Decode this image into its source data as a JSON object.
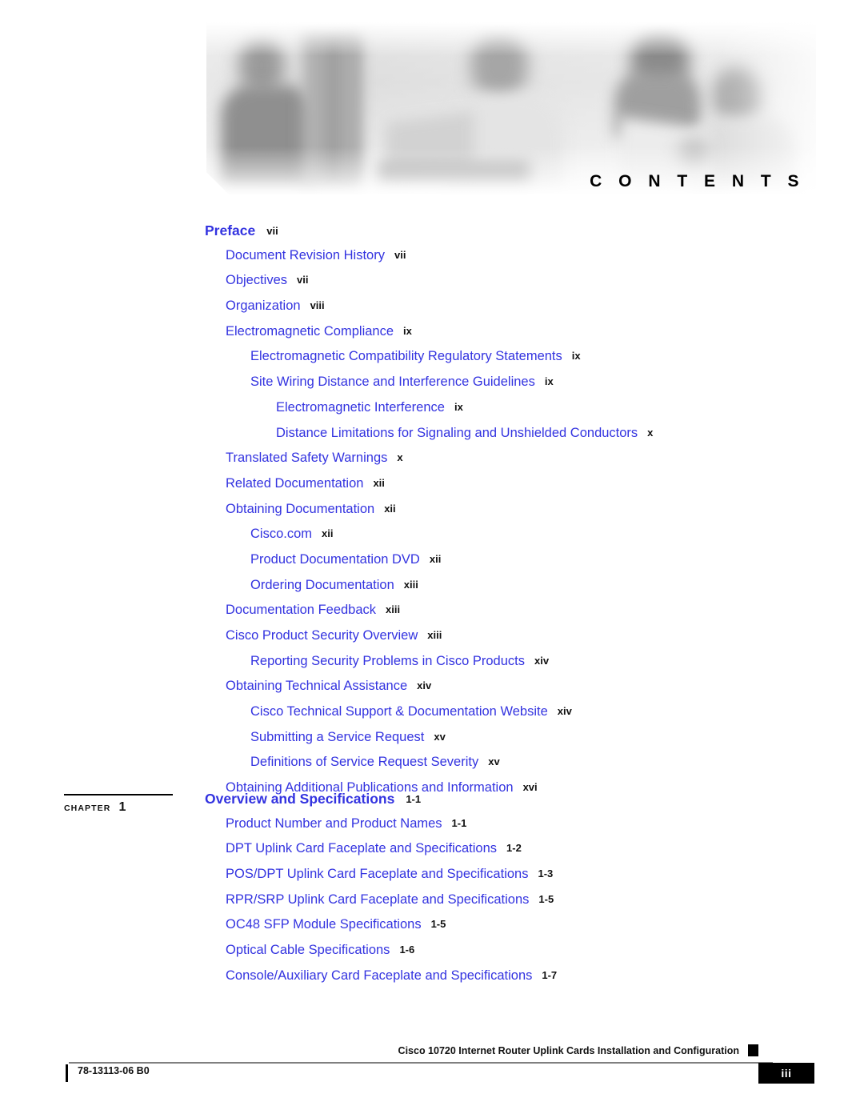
{
  "banner": {
    "title": "C O N T E N T S",
    "title_plain": "CONTENTS"
  },
  "toc": {
    "preface": {
      "heading": {
        "label": "Preface",
        "page": "vii",
        "level": 0
      },
      "entries": [
        {
          "label": "Document Revision History",
          "page": "vii",
          "level": 1
        },
        {
          "label": "Objectives",
          "page": "vii",
          "level": 1
        },
        {
          "label": "Organization",
          "page": "viii",
          "level": 1
        },
        {
          "label": "Electromagnetic Compliance",
          "page": "ix",
          "level": 1
        },
        {
          "label": "Electromagnetic Compatibility Regulatory Statements",
          "page": "ix",
          "level": 2
        },
        {
          "label": "Site Wiring Distance and Interference Guidelines",
          "page": "ix",
          "level": 2
        },
        {
          "label": "Electromagnetic Interference",
          "page": "ix",
          "level": 3
        },
        {
          "label": "Distance Limitations for Signaling and Unshielded Conductors",
          "page": "x",
          "level": 3
        },
        {
          "label": "Translated Safety Warnings",
          "page": "x",
          "level": 1
        },
        {
          "label": "Related Documentation",
          "page": "xii",
          "level": 1
        },
        {
          "label": "Obtaining Documentation",
          "page": "xii",
          "level": 1
        },
        {
          "label": "Cisco.com",
          "page": "xii",
          "level": 2
        },
        {
          "label": "Product Documentation DVD",
          "page": "xii",
          "level": 2
        },
        {
          "label": "Ordering Documentation",
          "page": "xiii",
          "level": 2
        },
        {
          "label": "Documentation Feedback",
          "page": "xiii",
          "level": 1
        },
        {
          "label": "Cisco Product Security Overview",
          "page": "xiii",
          "level": 1
        },
        {
          "label": "Reporting Security Problems in Cisco Products",
          "page": "xiv",
          "level": 2
        },
        {
          "label": "Obtaining Technical Assistance",
          "page": "xiv",
          "level": 1
        },
        {
          "label": "Cisco Technical Support & Documentation Website",
          "page": "xiv",
          "level": 2
        },
        {
          "label": "Submitting a Service Request",
          "page": "xv",
          "level": 2
        },
        {
          "label": "Definitions of Service Request Severity",
          "page": "xv",
          "level": 2
        },
        {
          "label": "Obtaining Additional Publications and Information",
          "page": "xvi",
          "level": 1
        }
      ]
    },
    "chapter1": {
      "tag_word": "CHAPTER",
      "tag_number": "1",
      "heading": {
        "label": "Overview and Specifications",
        "page": "1-1",
        "level": 0
      },
      "entries": [
        {
          "label": "Product Number and Product Names",
          "page": "1-1",
          "level": 1
        },
        {
          "label": "DPT Uplink Card Faceplate and Specifications",
          "page": "1-2",
          "level": 1
        },
        {
          "label": "POS/DPT Uplink Card Faceplate and Specifications",
          "page": "1-3",
          "level": 1
        },
        {
          "label": "RPR/SRP Uplink Card Faceplate and Specifications",
          "page": "1-5",
          "level": 1
        },
        {
          "label": "OC48 SFP Module Specifications",
          "page": "1-5",
          "level": 1
        },
        {
          "label": "Optical Cable Specifications",
          "page": "1-6",
          "level": 1
        },
        {
          "label": "Console/Auxiliary Card Faceplate and Specifications",
          "page": "1-7",
          "level": 1
        }
      ]
    }
  },
  "footer": {
    "title": "Cisco 10720 Internet Router Uplink Cards Installation and Configuration",
    "doc_number": "78-13113-06 B0",
    "page_number": "iii"
  },
  "colors": {
    "link_blue": "#3333e0",
    "page_black": "#111111",
    "tab_black": "#000000"
  }
}
